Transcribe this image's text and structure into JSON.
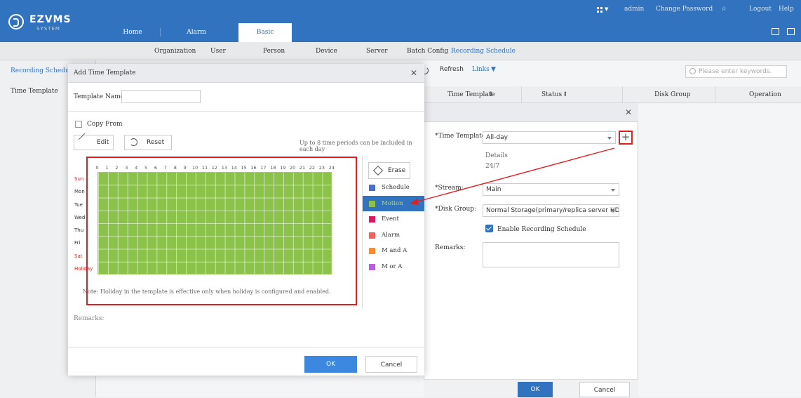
{
  "app": {
    "logo_title": "EZVMS",
    "logo_subtitle": "SYSTEM"
  },
  "topnav": {
    "tabs": [
      "Home",
      "Alarm Configuration",
      "Basic"
    ],
    "active_tab": "Basic"
  },
  "toplinks": {
    "user": "admin",
    "change_password": "Change Password",
    "logout": "Logout",
    "help": "Help"
  },
  "subnav": {
    "items": [
      "Organization",
      "User",
      "Person",
      "Device",
      "Server",
      "Batch Config",
      "Recording Schedule"
    ],
    "active": "Recording Schedule"
  },
  "leftnav": {
    "items": [
      "Recording Schedule",
      "Time Template"
    ],
    "active": "Recording Schedule"
  },
  "background": {
    "refresh_label": "Refresh",
    "links_label": "Links",
    "search_placeholder": "Please enter keywords.",
    "columns": [
      "Time Template",
      "Status",
      "Disk Group",
      "Operation"
    ]
  },
  "recording_dialog": {
    "time_template_label": "*Time Template:",
    "time_template_value": "All-day",
    "details_label": "Details",
    "details_value": "24/7",
    "stream_label": "*Stream:",
    "stream_value": "Main",
    "disk_group_label": "*Disk Group:",
    "disk_group_value": "Normal Storage(primary/replica server HDD",
    "enable_label": "Enable Recording Schedule",
    "remarks_label": "Remarks:",
    "ok_label": "OK",
    "cancel_label": "Cancel"
  },
  "template_dialog": {
    "title": "Add Time Template",
    "name_label": "Template Name:",
    "name_value": "",
    "copy_from_label": "Copy From",
    "edit_label": "Edit",
    "reset_label": "Reset",
    "hint": "Up to 8 time periods can be included in each day",
    "hours": [
      "0",
      "1",
      "2",
      "3",
      "4",
      "5",
      "6",
      "7",
      "8",
      "9",
      "10",
      "11",
      "12",
      "13",
      "14",
      "15",
      "16",
      "17",
      "18",
      "19",
      "20",
      "21",
      "22",
      "23",
      "24"
    ],
    "days": [
      {
        "label": "Sun",
        "red": true
      },
      {
        "label": "Mon",
        "red": false
      },
      {
        "label": "Tue",
        "red": false
      },
      {
        "label": "Wed",
        "red": false
      },
      {
        "label": "Thu",
        "red": false
      },
      {
        "label": "Fri",
        "red": false
      },
      {
        "label": "Sat",
        "red": true
      },
      {
        "label": "Holiday",
        "red": true
      }
    ],
    "note": "Note: Holiday in the template is effective only when holiday is configured and enabled.",
    "erase_label": "Erase",
    "legend": [
      {
        "label": "Schedule",
        "color": "#4a6fc9"
      },
      {
        "label": "Motion",
        "color": "#8bc34a",
        "selected": true
      },
      {
        "label": "Event",
        "color": "#d81b60"
      },
      {
        "label": "Alarm",
        "color": "#f4605a"
      },
      {
        "label": "M and A",
        "color": "#ff8a2a"
      },
      {
        "label": "M or A",
        "color": "#b562d6"
      }
    ],
    "remarks_label": "Remarks:",
    "ok_label": "OK",
    "cancel_label": "Cancel"
  },
  "colors": {
    "brand": "#3173bf",
    "motion": "#8bc34a",
    "annotation": "#e02020"
  }
}
